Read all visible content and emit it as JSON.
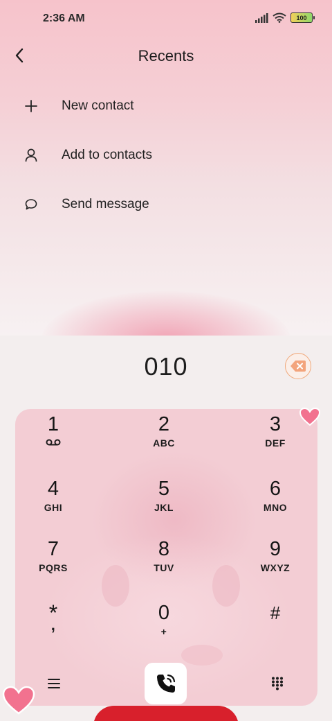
{
  "status_bar": {
    "time": "2:36 AM",
    "battery": "100",
    "icons": [
      "signal-icon",
      "wifi-icon",
      "battery-icon"
    ]
  },
  "header": {
    "title": "Recents",
    "back_icon": "chevron-left-icon"
  },
  "menu": [
    {
      "icon": "plus-icon",
      "label": "New contact"
    },
    {
      "icon": "person-icon",
      "label": "Add to contacts"
    },
    {
      "icon": "chat-bubble-icon",
      "label": "Send message"
    }
  ],
  "dialer": {
    "number": "010",
    "delete_icon": "backspace-icon",
    "keys": [
      {
        "digit": "1",
        "letters": ""
      },
      {
        "digit": "2",
        "letters": "ABC"
      },
      {
        "digit": "3",
        "letters": "DEF"
      },
      {
        "digit": "4",
        "letters": "GHI"
      },
      {
        "digit": "5",
        "letters": "JKL"
      },
      {
        "digit": "6",
        "letters": "MNO"
      },
      {
        "digit": "7",
        "letters": "PQRS"
      },
      {
        "digit": "8",
        "letters": "TUV"
      },
      {
        "digit": "9",
        "letters": "WXYZ"
      },
      {
        "digit": "*",
        "letters": ","
      },
      {
        "digit": "0",
        "letters": "+"
      },
      {
        "digit": "#",
        "letters": ""
      }
    ],
    "bottom": {
      "menu_icon": "hamburger-menu-icon",
      "call_icon": "phone-call-icon",
      "keypad_icon": "dialpad-icon"
    }
  },
  "colors": {
    "accent_orange": "#f0a87a",
    "pink_panel": "#f3cdd4",
    "top_gradient": "#f6c3cb",
    "heart": "#f2728f"
  }
}
